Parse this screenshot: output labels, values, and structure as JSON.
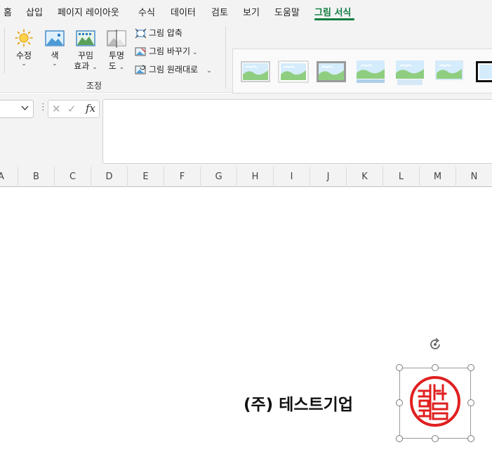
{
  "menu": {
    "tabs": [
      "홈",
      "삽입",
      "페이지 레이아웃",
      "수식",
      "데이터",
      "검토",
      "보기",
      "도움말",
      "그림 서식"
    ],
    "active_tab": "그림 서식"
  },
  "ribbon": {
    "corrections": {
      "label": "수정"
    },
    "color": {
      "label": "색"
    },
    "artistic": {
      "label_line1": "꾸밈",
      "label_line2": "효과"
    },
    "transparency": {
      "label_line1": "투명",
      "label_line2": "도"
    },
    "compress": {
      "label": "그림 압축"
    },
    "change": {
      "label": "그림 바꾸기"
    },
    "reset": {
      "label": "그림 원래대로"
    },
    "group_label": "조정",
    "chevron": "⌄"
  },
  "picture_styles": {
    "count": 7
  },
  "formula_bar": {
    "name_box_value": "",
    "formula_value": "",
    "cancel_symbol": "✕",
    "enter_symbol": "✓",
    "fx_label": "fx"
  },
  "columns": [
    "A",
    "B",
    "C",
    "D",
    "E",
    "F",
    "G",
    "H",
    "I",
    "J",
    "K",
    "L",
    "M",
    "N"
  ],
  "sheet": {
    "company_text": "(주) 테스트기업"
  },
  "colors": {
    "accent": "#107c41",
    "stamp_red": "#e02020"
  }
}
